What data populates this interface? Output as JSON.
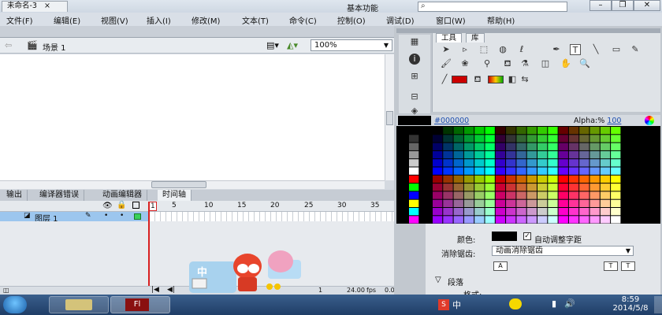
{
  "app": {
    "logo": "Fl",
    "workspace": "基本功能",
    "search_icon": "search-icon"
  },
  "menu": [
    "文件(F)",
    "编辑(E)",
    "视图(V)",
    "插入(I)",
    "修改(M)",
    "文本(T)",
    "命令(C)",
    "控制(O)",
    "调试(D)",
    "窗口(W)",
    "帮助(H)"
  ],
  "document": {
    "tab": "未命名-3",
    "tab_close": "×",
    "scene": "场景 1",
    "zoom": "100%"
  },
  "bottom_tabs": [
    "输出",
    "编译器错误",
    "动画编辑器",
    "时间轴"
  ],
  "timeline": {
    "ruler": [
      "1",
      "5",
      "10",
      "15",
      "20",
      "25",
      "30",
      "35"
    ],
    "layer_name": "图层 1",
    "current_frame": "1",
    "fps": "24.00",
    "fps_unit": "fps",
    "time": "0.0"
  },
  "tools": {
    "tab_tools": "工具",
    "tab_library": "库"
  },
  "swatches": {
    "hex": "#000000",
    "alpha_label": "Alpha:%",
    "alpha_value": "100"
  },
  "properties": {
    "color_label": "颜色:",
    "auto_kern": "自动调整字距",
    "antialias_label": "消除锯齿:",
    "antialias_value": "动画消除锯齿",
    "paragraph": "段落",
    "format_label": "格式:"
  },
  "ad": {
    "char": "中"
  },
  "taskbar": {
    "time": "8:59",
    "date": "2014/5/8",
    "app_label": "Fl"
  },
  "colors": {
    "stroke": "#000000",
    "fill": "#cc0000",
    "selection": "#9cc6ee"
  }
}
